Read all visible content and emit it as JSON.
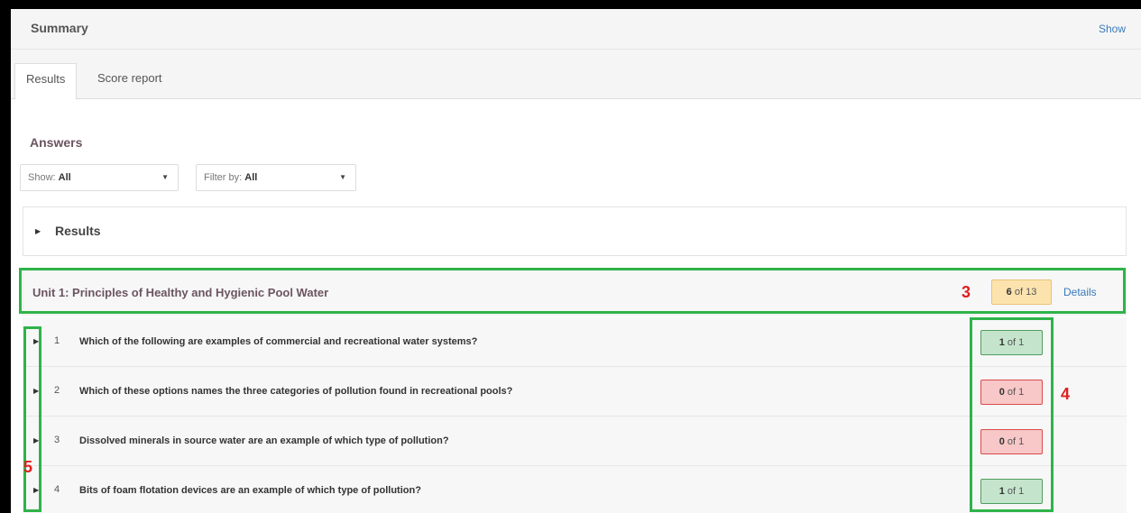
{
  "header": {
    "title": "Summary",
    "show_link": "Show"
  },
  "tabs": [
    {
      "label": "Results",
      "active": true
    },
    {
      "label": "Score report",
      "active": false
    }
  ],
  "answers": {
    "heading": "Answers",
    "show_select": {
      "label": "Show:",
      "value": "All"
    },
    "filter_select": {
      "label": "Filter by:",
      "value": "All"
    }
  },
  "results_section": {
    "label": "Results"
  },
  "unit": {
    "title": "Unit 1: Principles of Healthy and Hygienic Pool Water",
    "score_num": "6",
    "score_rest": "of 13",
    "details_label": "Details"
  },
  "questions": [
    {
      "number": "1",
      "text": "Which of the following are examples of commercial and recreational water systems?",
      "score_num": "1",
      "score_rest": "of 1",
      "status": "correct"
    },
    {
      "number": "2",
      "text": "Which of these options names the three categories of pollution found in recreational pools?",
      "score_num": "0",
      "score_rest": "of 1",
      "status": "incorrect"
    },
    {
      "number": "3",
      "text": "Dissolved minerals in source water are an example of which type of pollution?",
      "score_num": "0",
      "score_rest": "of 1",
      "status": "incorrect"
    },
    {
      "number": "4",
      "text": "Bits of foam flotation devices are an example of which type of pollution?",
      "score_num": "1",
      "score_rest": "of 1",
      "status": "correct"
    }
  ],
  "annotations": {
    "unit_marker": "3",
    "score_marker": "4",
    "expand_marker": "5"
  },
  "colors": {
    "annotation_box": "#2fb34a",
    "annotation_number": "#e02020",
    "badge_correct": "#c4e5cc",
    "badge_incorrect": "#f8c7c7",
    "badge_unit": "#fce3ae",
    "link": "#3a7ab8"
  },
  "icons": {
    "expand": "caret-right-icon",
    "dropdown": "caret-down-icon"
  }
}
